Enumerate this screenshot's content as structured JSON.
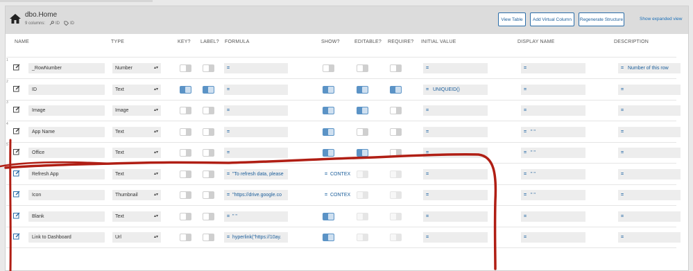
{
  "header": {
    "title": "dbo.Home",
    "columns_count": "9 columns:",
    "key_meta": "ID",
    "label_meta": "ID",
    "buttons": [
      "View Table",
      "Add Virtual Column",
      "Regenerate Structure"
    ],
    "link": "Show expanded view"
  },
  "columns": [
    "NAME",
    "TYPE",
    "KEY?",
    "LABEL?",
    "FORMULA",
    "SHOW?",
    "EDITABLE?",
    "REQUIRE?",
    "INITIAL VALUE",
    "DISPLAY NAME",
    "DESCRIPTION"
  ],
  "rows": [
    {
      "num": "1",
      "name": "_RowNumber",
      "type": "Number",
      "formula": "",
      "show_formula": "",
      "initial": "",
      "display": "",
      "description": "Number of this row"
    },
    {
      "num": "2",
      "name": "ID",
      "type": "Text",
      "formula": "",
      "show_formula": "",
      "initial": "UNIQUEID()",
      "display": "",
      "description": ""
    },
    {
      "num": "3",
      "name": "Image",
      "type": "Image",
      "formula": "",
      "show_formula": "",
      "initial": "",
      "display": "",
      "description": ""
    },
    {
      "num": "4",
      "name": "App Name",
      "type": "Text",
      "formula": "",
      "show_formula": "",
      "initial": "",
      "display": "\" \"",
      "description": ""
    },
    {
      "num": "5",
      "name": "Office",
      "type": "Text",
      "formula": "",
      "show_formula": "",
      "initial": "",
      "display": "\" \"",
      "description": ""
    },
    {
      "num": "",
      "name": "Refresh App",
      "type": "Text",
      "formula": "\"To refresh data, please",
      "show_formula": "CONTEX",
      "initial": "",
      "display": "\" \"",
      "description": ""
    },
    {
      "num": "",
      "name": "Icon",
      "type": "Thumbnail",
      "formula": "\"https://drive.google.co",
      "show_formula": "CONTEX",
      "initial": "",
      "display": "\" \"",
      "description": ""
    },
    {
      "num": "",
      "name": "Blank",
      "type": "Text",
      "formula": "\" \"",
      "show_formula": "",
      "initial": "",
      "display": "",
      "description": ""
    },
    {
      "num": "",
      "name": "Link to Dashboard",
      "type": "Url",
      "formula": "hyperlink(\"https://10ay.",
      "show_formula": "",
      "initial": "",
      "display": "",
      "description": ""
    }
  ],
  "toggle_states": [
    {
      "key": "off",
      "label": "off",
      "show": "off",
      "editable": "off",
      "require": "off"
    },
    {
      "key": "on",
      "label": "on",
      "show": "on",
      "editable": "on",
      "require": "on"
    },
    {
      "key": "off",
      "label": "off",
      "show": "on",
      "editable": "on",
      "require": "off"
    },
    {
      "key": "off",
      "label": "off",
      "show": "on",
      "editable": "off",
      "require": "off"
    },
    {
      "key": "off",
      "label": "off",
      "show": "on",
      "editable": "on",
      "require": "off"
    },
    {
      "key": "off",
      "label": "off",
      "show": "none",
      "editable": "dim",
      "require": "dim"
    },
    {
      "key": "off",
      "label": "off",
      "show": "none",
      "editable": "dim",
      "require": "dim"
    },
    {
      "key": "off",
      "label": "off",
      "show": "on",
      "editable": "dim",
      "require": "dim"
    },
    {
      "key": "off",
      "label": "off",
      "show": "on",
      "editable": "dim",
      "require": "dim"
    }
  ],
  "colors": {
    "accent": "#1a5d9a",
    "toggle_on": "#5b93c6",
    "annotation": "#b01e14"
  }
}
